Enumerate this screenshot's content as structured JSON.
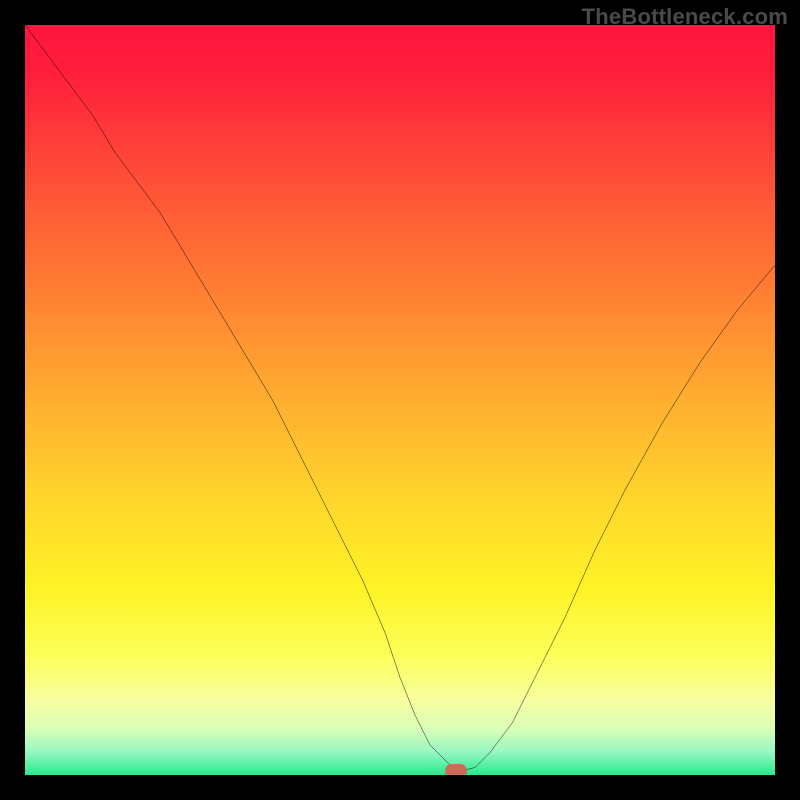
{
  "watermark": "TheBottleneck.com",
  "chart_data": {
    "type": "line",
    "title": "",
    "xlabel": "",
    "ylabel": "",
    "xlim": [
      0,
      100
    ],
    "ylim": [
      0,
      100
    ],
    "grid": false,
    "series": [
      {
        "name": "bottleneck-curve",
        "x": [
          0,
          3,
          6,
          9,
          12,
          15,
          18,
          21,
          24,
          27,
          30,
          33,
          36,
          39,
          42,
          45,
          48,
          50,
          52,
          54,
          56,
          57,
          58,
          60,
          62,
          65,
          68,
          72,
          76,
          80,
          85,
          90,
          95,
          100
        ],
        "values": [
          100,
          96,
          92,
          88,
          83,
          79,
          75,
          70,
          65,
          60,
          55,
          50,
          44,
          38,
          32,
          26,
          19,
          13,
          8,
          4,
          2,
          1,
          0.5,
          1,
          3,
          7,
          13,
          21,
          30,
          38,
          47,
          55,
          62,
          68
        ]
      }
    ],
    "annotations": [
      {
        "name": "min-marker",
        "x": 57.5,
        "y": 0.5
      }
    ],
    "background": {
      "type": "vertical-gradient",
      "stops": [
        {
          "pos": 0,
          "color": "#ff163e"
        },
        {
          "pos": 35,
          "color": "#ff7d33"
        },
        {
          "pos": 62,
          "color": "#ffd22c"
        },
        {
          "pos": 84,
          "color": "#fdff58"
        },
        {
          "pos": 97,
          "color": "#94f7c2"
        },
        {
          "pos": 100,
          "color": "#27e98a"
        }
      ]
    }
  }
}
